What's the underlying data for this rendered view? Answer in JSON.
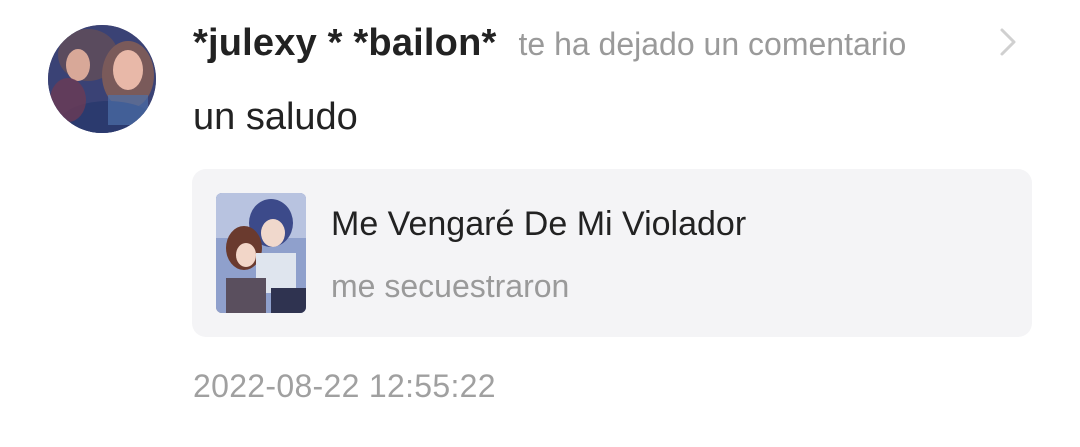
{
  "notification": {
    "username": "*julexy * *bailon*",
    "action_text": "te ha dejado un comentario",
    "comment": "un saludo",
    "timestamp": "2022-08-22 12:55:22",
    "avatar_icon": "user-avatar-photo",
    "chevron_icon": "chevron-right-icon"
  },
  "story_card": {
    "title": "Me Vengaré De Mi Violador",
    "subtitle": "me secuestraron",
    "cover_icon": "story-cover-illustration"
  },
  "colors": {
    "primary_text": "#222222",
    "secondary_text": "#9a9a9a",
    "card_background": "#f4f4f6",
    "chevron": "#d0d0d0"
  }
}
